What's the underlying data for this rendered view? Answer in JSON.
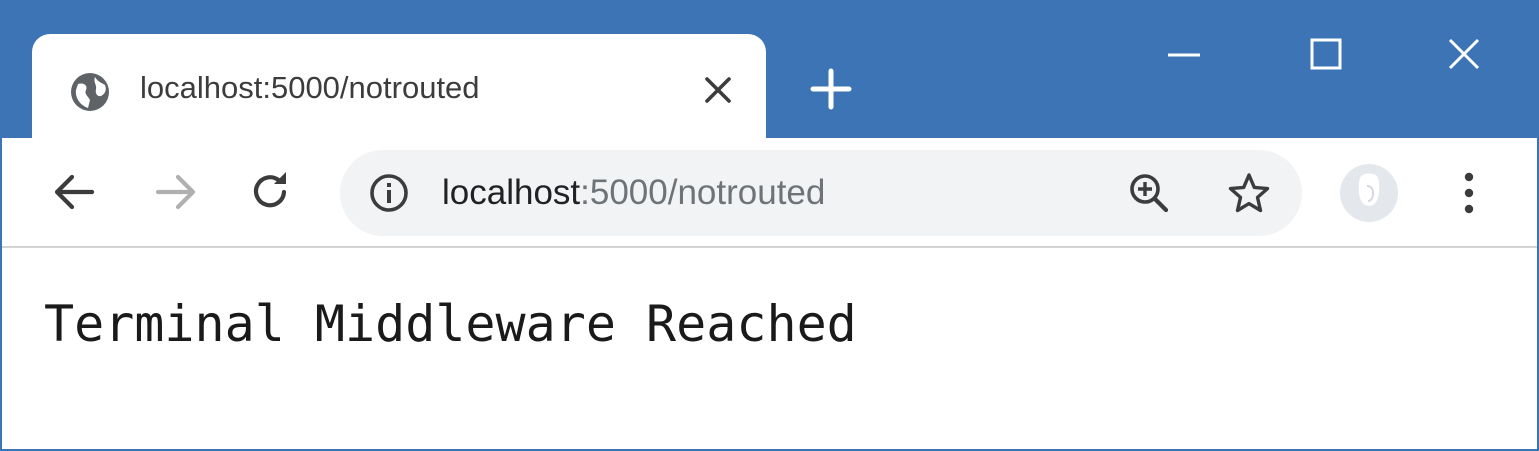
{
  "tab": {
    "title": "localhost:5000/notrouted",
    "favicon": "globe-icon"
  },
  "address_bar": {
    "host": "localhost",
    "rest": ":5000/notrouted"
  },
  "page": {
    "text": "Terminal Middleware Reached"
  },
  "icons": {
    "tab_close": "close-icon",
    "new_tab": "plus-icon",
    "minimize": "minimize-icon",
    "maximize": "maximize-icon",
    "window_close": "close-icon",
    "back": "arrow-left-icon",
    "forward": "arrow-right-icon",
    "reload": "reload-icon",
    "site_info": "info-icon",
    "zoom": "zoom-icon",
    "bookmark": "star-icon",
    "profile": "avatar-icon",
    "menu": "more-vertical-icon"
  },
  "colors": {
    "titlebar": "#3c74b6",
    "omnibox": "#f1f3f4",
    "url_host": "#202124",
    "url_rest": "#6e7378",
    "forward_disabled": "#b0b0b0"
  }
}
